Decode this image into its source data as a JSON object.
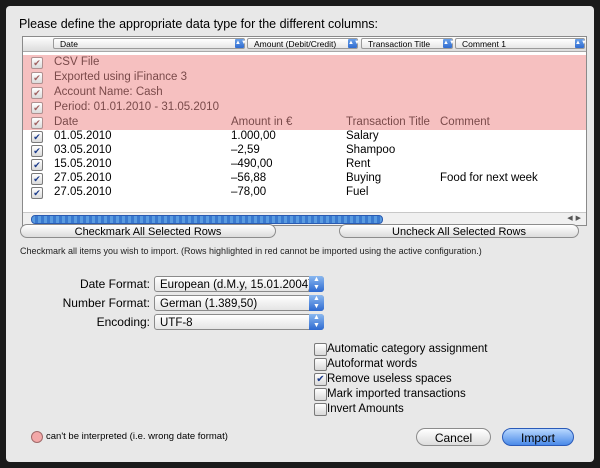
{
  "title": "Please define the appropriate data type for the different columns:",
  "column_selectors": [
    {
      "label": "Date"
    },
    {
      "label": "Amount (Debit/Credit)"
    },
    {
      "label": "Transaction Title"
    },
    {
      "label": "Comment 1"
    }
  ],
  "rows": [
    {
      "checked": true,
      "red": true,
      "date": "CSV File",
      "amount": "",
      "title": "",
      "comment": ""
    },
    {
      "checked": true,
      "red": true,
      "date": "Exported using iFinance 3",
      "amount": "",
      "title": "",
      "comment": ""
    },
    {
      "checked": true,
      "red": true,
      "date": "Account Name: Cash",
      "amount": "",
      "title": "",
      "comment": ""
    },
    {
      "checked": true,
      "red": true,
      "date": "Period: 01.01.2010 - 31.05.2010",
      "amount": "",
      "title": "",
      "comment": ""
    },
    {
      "checked": true,
      "red": true,
      "date": "Date",
      "amount": "Amount in €",
      "title": "Transaction Title",
      "comment": "Comment"
    },
    {
      "checked": true,
      "red": false,
      "date": "01.05.2010",
      "amount": "1.000,00",
      "title": "Salary",
      "comment": ""
    },
    {
      "checked": true,
      "red": false,
      "date": "03.05.2010",
      "amount": "–2,59",
      "title": "Shampoo",
      "comment": ""
    },
    {
      "checked": true,
      "red": false,
      "date": "15.05.2010",
      "amount": "–490,00",
      "title": "Rent",
      "comment": ""
    },
    {
      "checked": true,
      "red": false,
      "date": "27.05.2010",
      "amount": "–56,88",
      "title": "Buying",
      "comment": "Food for next week"
    },
    {
      "checked": true,
      "red": false,
      "date": "27.05.2010",
      "amount": "–78,00",
      "title": "Fuel",
      "comment": ""
    }
  ],
  "buttons": {
    "checkmark_all": "Checkmark All Selected Rows",
    "uncheck_all": "Uncheck All Selected Rows",
    "cancel": "Cancel",
    "import": "Import"
  },
  "hint": "Checkmark all items you wish to import. (Rows highlighted in red cannot be imported using the active configuration.)",
  "fields": {
    "date_format": {
      "label": "Date Format:",
      "value": "European (d.M.y, 15.01.2004)"
    },
    "number_format": {
      "label": "Number Format:",
      "value": "German (1.389,50)"
    },
    "encoding": {
      "label": "Encoding:",
      "value": "UTF-8"
    }
  },
  "options": [
    {
      "label": "Automatic category assignment",
      "checked": false
    },
    {
      "label": "Autoformat words",
      "checked": false
    },
    {
      "label": "Remove useless spaces",
      "checked": true
    },
    {
      "label": "Mark imported transactions",
      "checked": false
    },
    {
      "label": "Invert Amounts",
      "checked": false
    }
  ],
  "legend": "can't be interpreted (i.e. wrong date format)",
  "colors": {
    "invalid_row": "#f6c0c0",
    "accent": "#3a7ad0"
  },
  "icons": {
    "checkmark": "✔",
    "popup_arrows": "▲▼",
    "scroll_arrows": "◀▶"
  }
}
